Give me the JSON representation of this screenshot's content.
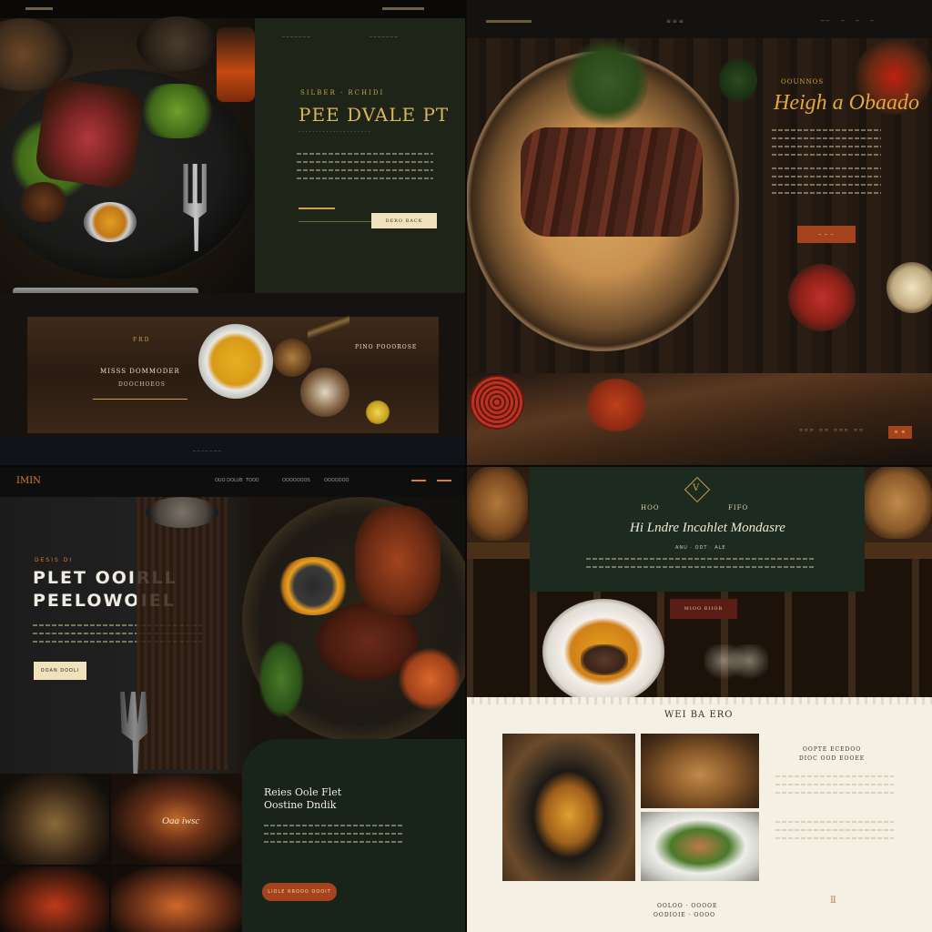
{
  "colors": {
    "olive_panel": "#1e2418",
    "gold": "#c9a24a",
    "orange_btn": "#a5441c",
    "cream": "#f0e2bd",
    "paper": "#f4f0e4",
    "dark_green": "#182419",
    "maroon_btn": "#5a1c14"
  },
  "q1": {
    "nav_links": [
      "─ ─ ─ ─ ─ ─ ─",
      "─ ─ ─ ─ ─ ─ ─"
    ],
    "kicker": "SILBER · RCHIDI",
    "title": "PEE DVALE PT",
    "subline": "· · · · · · · · · · · · · · · · · · · · ·",
    "cta": "DERO BACK",
    "section_label": "FRD",
    "section_title": "MISSS DOMMODER",
    "section_sub": "DOOCHOEOS",
    "section_right": "PINO POOOROSE",
    "footer_dots": "─ ─ ─ ─ ─ ─ ─"
  },
  "q2": {
    "nav_links": [
      "≡ ≡ ≡",
      "─ ─",
      "─",
      "─",
      "─"
    ],
    "kicker": "OOUNNOS",
    "title": "Heigh a Obaado",
    "cta": "─ ─ ─",
    "footer_links": [
      "≡ ≡ ≡",
      "≡ ≡",
      "≡ ≡ ≡",
      "≡ ≡"
    ],
    "footer_btn": "≡ ≡"
  },
  "q3": {
    "logo": "IMIN",
    "nav_links": [
      "OUO DOLUB",
      "TOOD",
      "OOOOOOOS",
      "OOOODOO"
    ],
    "kicker": "DESIS DI",
    "title_1": "PLET OOIRLL",
    "title_2": "PEELOWOIEL",
    "cta": "OOAN DOOLI",
    "photo_caption": "Oaa iwsc",
    "sub_title_1": "Reies Oole Flet",
    "sub_title_2": "Oostine Dndik",
    "sub_cta": "LIOLE RROOO OOOIT"
  },
  "q4": {
    "emblem": "V",
    "label_left": "HOO",
    "label_right": "FIFO",
    "title": "Hi Lndre Incahlet Mondasre",
    "meta": "ANU  ·  ODT  ·  ALE",
    "cta": "MIOO RIIOR",
    "section_title": "WEI BA ERO",
    "side_heading_1": "OOPTE ECEDOO",
    "side_heading_2": "DIOC OOD EOOEE",
    "side_icon": "Ⅱ",
    "footer_1": "OOLOO  · OOOOE",
    "footer_2": "OODIOIE  ·  OOOO"
  }
}
